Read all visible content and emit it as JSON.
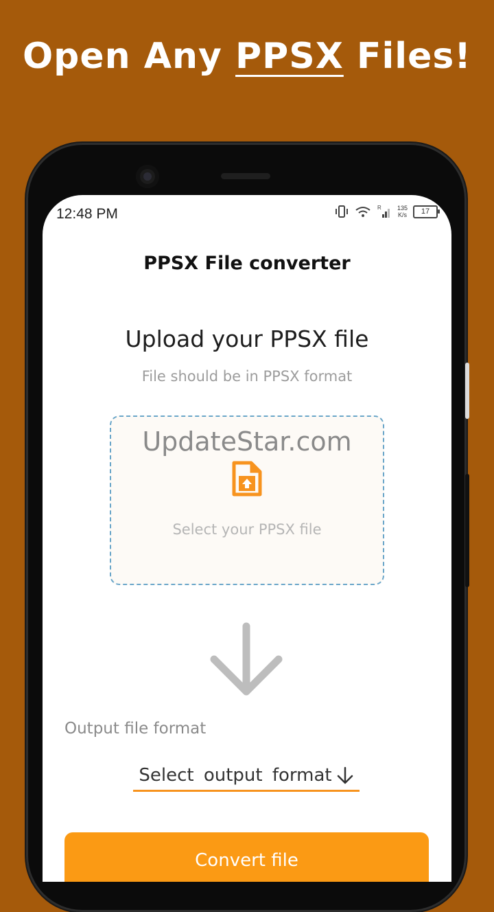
{
  "banner": {
    "prefix": "Open Any",
    "highlight": "PPSX",
    "suffix": "Files!"
  },
  "status_bar": {
    "time": "12:48 PM",
    "net_speed_value": "135",
    "net_speed_unit": "K/s",
    "battery": "17",
    "icons": [
      "vibrate-icon",
      "wifi-icon",
      "signal-icon",
      "battery-icon"
    ]
  },
  "app": {
    "title": "PPSX File converter",
    "upload_title": "Upload your PPSX file",
    "upload_subtitle": "File should be in PPSX format",
    "dropzone": {
      "watermark": "UpdateStar.com",
      "label": "Select your PPSX file",
      "icon": "file-upload-icon"
    },
    "output_label": "Output file format",
    "output_select": "Select  output  format",
    "convert_button": "Convert file"
  },
  "colors": {
    "background": "#a55a0b",
    "accent": "#fb9a14",
    "dropzone_border": "#6aa6c9"
  }
}
